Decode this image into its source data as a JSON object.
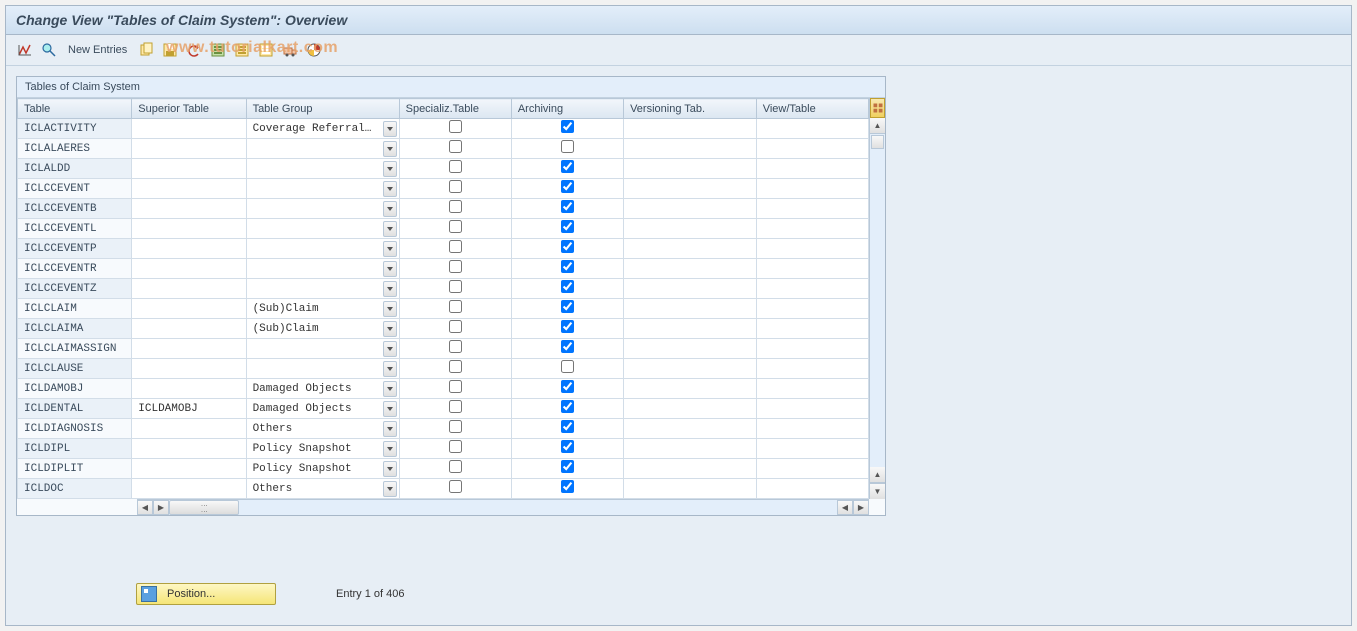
{
  "title": "Change View \"Tables of Claim System\": Overview",
  "toolbar": {
    "new_entries": "New Entries"
  },
  "watermark": "www.tutorialkart.com",
  "group_label": "Tables of Claim System",
  "columns": {
    "table": "Table",
    "superior": "Superior Table",
    "group": "Table Group",
    "specializ": "Specializ.Table",
    "archiving": "Archiving",
    "versioning": "Versioning Tab.",
    "view": "View/Table"
  },
  "rows": [
    {
      "table": "ICLACTIVITY",
      "superior": "",
      "group": "Coverage Referral…",
      "spec": false,
      "arch": true
    },
    {
      "table": "ICLALAERES",
      "superior": "",
      "group": "",
      "spec": false,
      "arch": false
    },
    {
      "table": "ICLALDD",
      "superior": "",
      "group": "",
      "spec": false,
      "arch": true
    },
    {
      "table": "ICLCCEVENT",
      "superior": "",
      "group": "",
      "spec": false,
      "arch": true
    },
    {
      "table": "ICLCCEVENTB",
      "superior": "",
      "group": "",
      "spec": false,
      "arch": true
    },
    {
      "table": "ICLCCEVENTL",
      "superior": "",
      "group": "",
      "spec": false,
      "arch": true
    },
    {
      "table": "ICLCCEVENTP",
      "superior": "",
      "group": "",
      "spec": false,
      "arch": true
    },
    {
      "table": "ICLCCEVENTR",
      "superior": "",
      "group": "",
      "spec": false,
      "arch": true
    },
    {
      "table": "ICLCCEVENTZ",
      "superior": "",
      "group": "",
      "spec": false,
      "arch": true
    },
    {
      "table": "ICLCLAIM",
      "superior": "",
      "group": "(Sub)Claim",
      "spec": false,
      "arch": true
    },
    {
      "table": "ICLCLAIMA",
      "superior": "",
      "group": "(Sub)Claim",
      "spec": false,
      "arch": true
    },
    {
      "table": "ICLCLAIMASSIGN",
      "superior": "",
      "group": "",
      "spec": false,
      "arch": true
    },
    {
      "table": "ICLCLAUSE",
      "superior": "",
      "group": "",
      "spec": false,
      "arch": false
    },
    {
      "table": "ICLDAMOBJ",
      "superior": "",
      "group": "Damaged Objects",
      "spec": false,
      "arch": true
    },
    {
      "table": "ICLDENTAL",
      "superior": "ICLDAMOBJ",
      "group": "Damaged Objects",
      "spec": false,
      "arch": true
    },
    {
      "table": "ICLDIAGNOSIS",
      "superior": "",
      "group": "Others",
      "spec": false,
      "arch": true
    },
    {
      "table": "ICLDIPL",
      "superior": "",
      "group": "Policy Snapshot",
      "spec": false,
      "arch": true
    },
    {
      "table": "ICLDIPLIT",
      "superior": "",
      "group": "Policy Snapshot",
      "spec": false,
      "arch": true
    },
    {
      "table": "ICLDOC",
      "superior": "",
      "group": "Others",
      "spec": false,
      "arch": true
    }
  ],
  "footer": {
    "position_label": "Position...",
    "entry_text": "Entry 1 of 406"
  }
}
